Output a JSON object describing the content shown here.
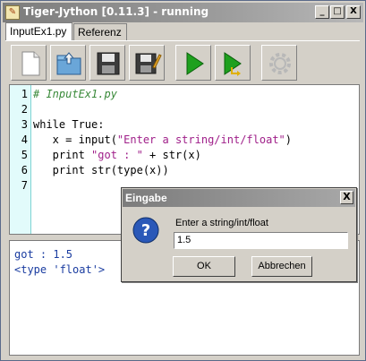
{
  "window": {
    "title": "Tiger-Jython [0.11.3] - running",
    "icon": "python-icon"
  },
  "window_controls": {
    "minimize": "_",
    "maximize": "□",
    "close": "X"
  },
  "tabs": [
    {
      "label": "InputEx1.py",
      "active": true
    },
    {
      "label": "Referenz",
      "active": false
    }
  ],
  "toolbar": {
    "buttons": [
      {
        "icon": "new-file-icon"
      },
      {
        "icon": "open-file-icon"
      },
      {
        "icon": "save-icon"
      },
      {
        "icon": "save-as-icon"
      },
      {
        "icon": "run-icon"
      },
      {
        "icon": "debug-run-icon"
      },
      {
        "icon": "gear-icon",
        "disabled": true
      }
    ]
  },
  "editor": {
    "line_numbers": [
      "1",
      "2",
      "3",
      "4",
      "5",
      "6",
      "7"
    ],
    "lines": [
      "# InputEx1.py",
      "",
      "while True:",
      "   x = input(\"Enter a string/int/float\")",
      "   print \"got : \" + str(x)",
      "   print str(type(x))",
      ""
    ],
    "code": {
      "l1_comment": "# InputEx1.py",
      "l3": "while True:",
      "l4_a": "   x = input(",
      "l4_str": "\"Enter a string/int/float\"",
      "l4_b": ")",
      "l5_a": "   print ",
      "l5_str": "\"got : \"",
      "l5_b": " + str(x)",
      "l6": "   print str(type(x))"
    }
  },
  "console": {
    "lines": [
      "got : 1.5",
      "<type 'float'>"
    ]
  },
  "dialog": {
    "title": "Eingabe",
    "close": "X",
    "message": "Enter a string/int/float",
    "input_value": "1.5",
    "ok_label": "OK",
    "cancel_label": "Abbrechen",
    "icon": "question-icon"
  },
  "colors": {
    "titlebar": "#8c8c8c",
    "gutter": "#e2fbfb",
    "comment": "#3a8a3a",
    "string": "#a0208a",
    "console_text": "#1a3ca0",
    "run_green": "#1ea01e"
  }
}
